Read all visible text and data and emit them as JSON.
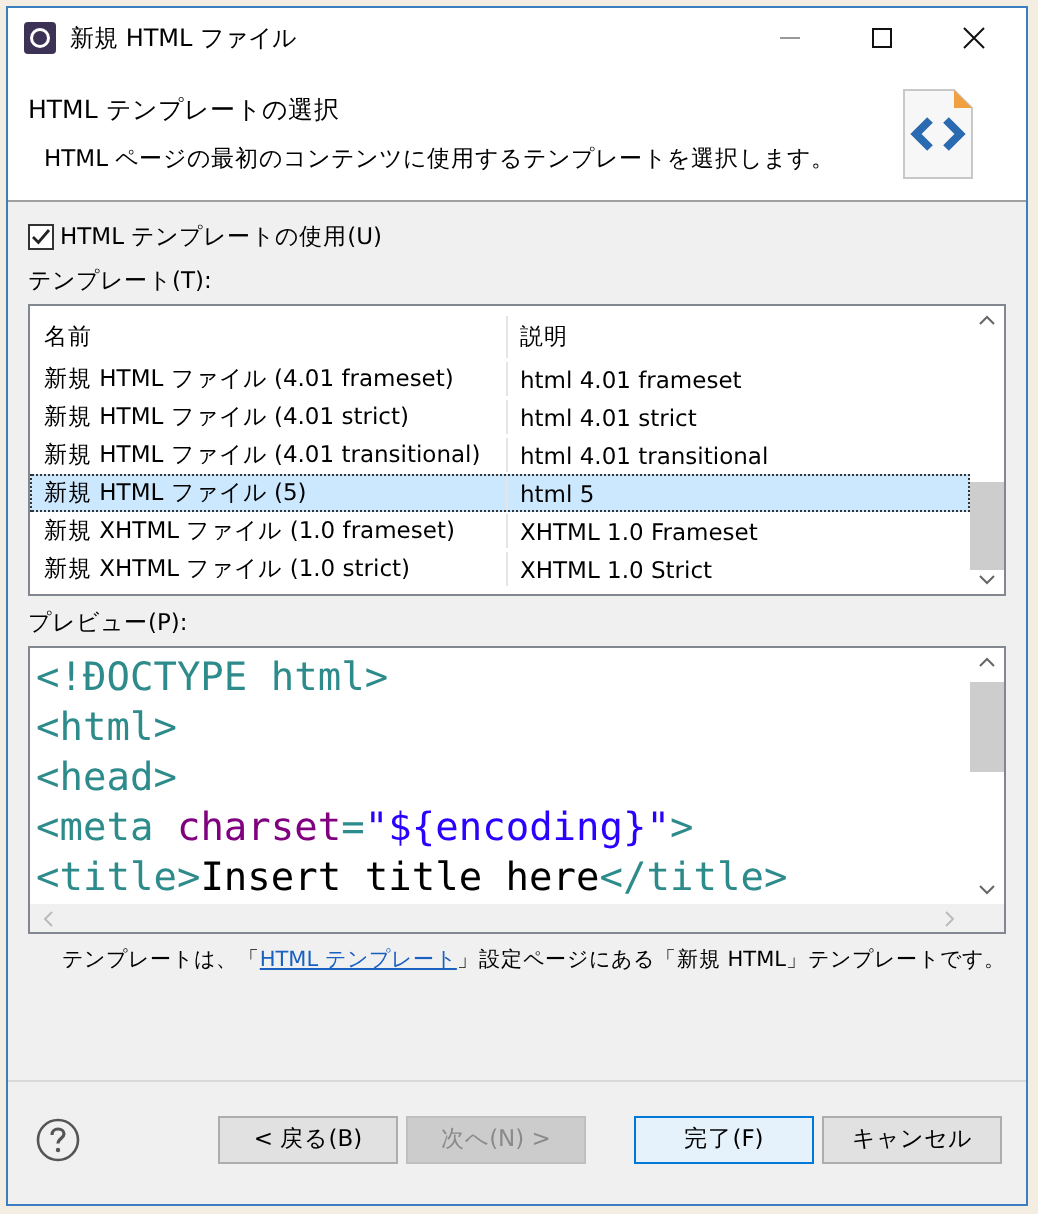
{
  "window": {
    "title": "新規 HTML ファイル"
  },
  "header": {
    "title": "HTML テンプレートの選択",
    "description": "HTML ページの最初のコンテンツに使用するテンプレートを選択します。"
  },
  "use_template": {
    "label": "HTML テンプレートの使用(U)",
    "checked": true
  },
  "templates": {
    "label": "テンプレート(T):",
    "columns": [
      "名前",
      "説明"
    ],
    "rows": [
      {
        "name": "新規 HTML ファイル (4.01 frameset)",
        "description": "html 4.01 frameset",
        "selected": false
      },
      {
        "name": "新規 HTML ファイル (4.01 strict)",
        "description": "html 4.01 strict",
        "selected": false
      },
      {
        "name": "新規 HTML ファイル (4.01 transitional)",
        "description": "html 4.01 transitional",
        "selected": false
      },
      {
        "name": "新規 HTML ファイル (5)",
        "description": "html 5",
        "selected": true
      },
      {
        "name": "新規 XHTML ファイル (1.0 frameset)",
        "description": "XHTML 1.0 Frameset",
        "selected": false
      },
      {
        "name": "新規 XHTML ファイル (1.0 strict)",
        "description": "XHTML 1.0 Strict",
        "selected": false
      }
    ]
  },
  "preview": {
    "label": "プレビュー(P):",
    "lines": [
      [
        {
          "kind": "tag",
          "text": "<!ÐOCTYPE html>"
        }
      ],
      [
        {
          "kind": "tag",
          "text": "<html>"
        }
      ],
      [
        {
          "kind": "tag",
          "text": "<head>"
        }
      ],
      [
        {
          "kind": "tag",
          "text": "<meta "
        },
        {
          "kind": "attr",
          "text": "charset"
        },
        {
          "kind": "tag",
          "text": "="
        },
        {
          "kind": "value",
          "text": "\"${encoding}\""
        },
        {
          "kind": "tag",
          "text": ">"
        }
      ],
      [
        {
          "kind": "tag",
          "text": "<title>"
        },
        {
          "kind": "text",
          "text": "Insert title here"
        },
        {
          "kind": "tag",
          "text": "</title>"
        }
      ]
    ]
  },
  "note": {
    "before": "テンプレートは、「",
    "link": "HTML テンプレート",
    "after": "」設定ページにある「新規 HTML」テンプレートです。"
  },
  "buttons": [
    {
      "label": "< 戻る(B)",
      "disabled": false,
      "default": false
    },
    {
      "label": "次へ(N) >",
      "disabled": true,
      "default": false
    },
    {
      "label": "完了(F)",
      "disabled": false,
      "default": true
    },
    {
      "label": "キャンセル",
      "disabled": false,
      "default": false
    }
  ]
}
